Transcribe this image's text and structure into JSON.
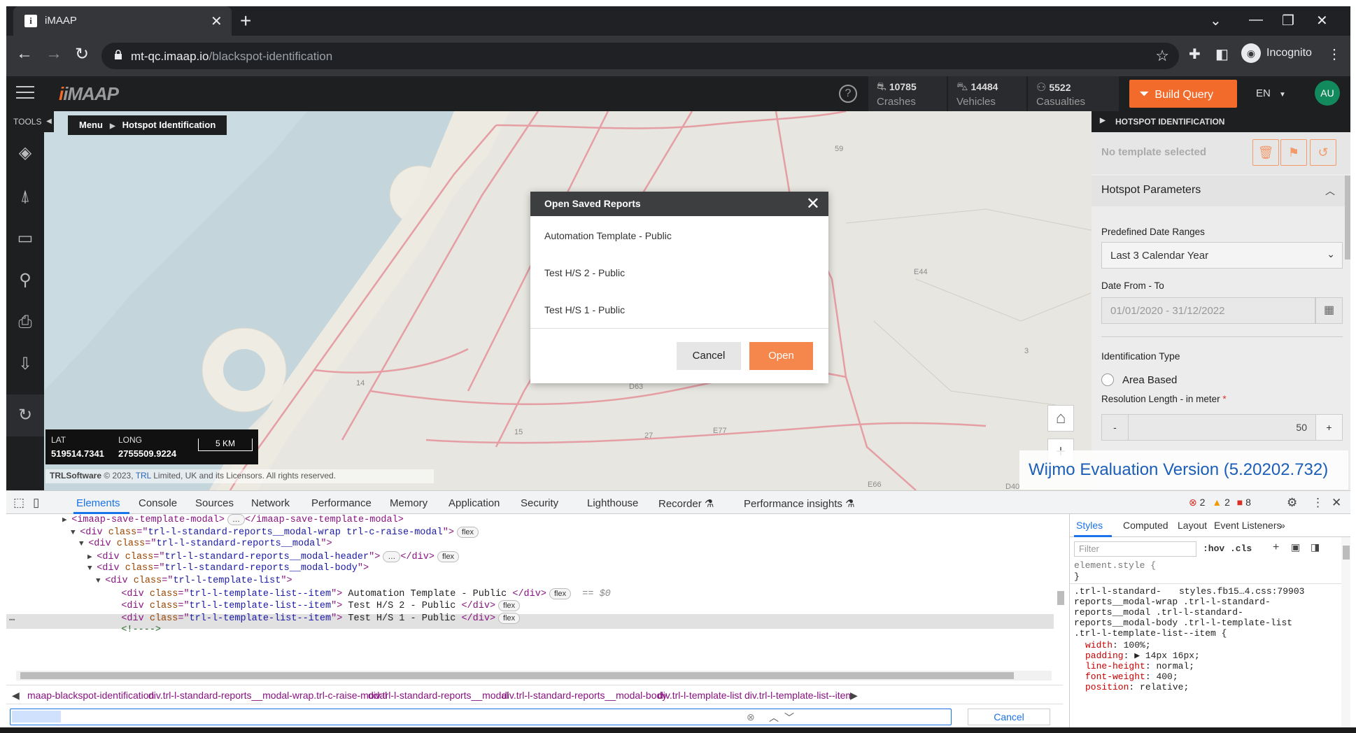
{
  "browser": {
    "tab_title": "iMAAP",
    "tab_favicon": "i",
    "url_host": "mt-qc.imaap.io",
    "url_path": "/blackspot-identification",
    "profile_label": "Incognito"
  },
  "app": {
    "logo_main": "iMAAP",
    "stats": [
      {
        "icon": "crash-icon",
        "value": "10785",
        "label": "Crashes"
      },
      {
        "icon": "car-icon",
        "value": "14484",
        "label": "Vehicles"
      },
      {
        "icon": "person-icon",
        "value": "5522",
        "label": "Casualties"
      }
    ],
    "build_query_label": "Build Query",
    "language": "EN",
    "avatar_initials": "AU",
    "accent_color": "#f36b2a"
  },
  "tools": {
    "label": "TOOLS"
  },
  "breadcrumb": {
    "root": "Menu",
    "current": "Hotspot Identification"
  },
  "map": {
    "lat_label": "LAT",
    "lat_value": "519514.7341",
    "long_label": "LONG",
    "long_value": "2755509.9224",
    "scale_label": "5 KM",
    "attribution_brand": "TRLSoftware",
    "attribution_pre": "© 2023, ",
    "attribution_link": "TRL",
    "attribution_post": " Limited, UK and its Licensors. All rights reserved.",
    "watermark": "Wijmo Evaluation Version (5.20202.732)",
    "road_labels": [
      "E44",
      "E77",
      "E66",
      "D40",
      "D63",
      "59",
      "27",
      "15",
      "14",
      "3"
    ]
  },
  "modal": {
    "title": "Open Saved Reports",
    "items": [
      "Automation Template - Public",
      "Test H/S 2 - Public",
      "Test H/S 1 - Public"
    ],
    "cancel_label": "Cancel",
    "open_label": "Open"
  },
  "panel": {
    "header": "HOTSPOT IDENTIFICATION",
    "template_placeholder": "No template selected",
    "section_title": "Hotspot Parameters",
    "date_ranges_label": "Predefined Date Ranges",
    "date_ranges_value": "Last 3 Calendar Year",
    "date_from_to_label": "Date From - To",
    "date_from_to_value": "01/01/2020 - 31/12/2022",
    "identification_type_label": "Identification Type",
    "area_based_label": "Area Based",
    "resolution_label": "Resolution Length - in meter",
    "required_mark": "*",
    "resolution_minus": "-",
    "resolution_value": "50",
    "resolution_plus": "+"
  },
  "devtools": {
    "tabs": [
      "Elements",
      "Console",
      "Sources",
      "Network",
      "Performance",
      "Memory",
      "Application",
      "Security",
      "Lighthouse",
      "Recorder",
      "Performance insights"
    ],
    "errors": "2",
    "warnings": "2",
    "issues": "8",
    "dom_lines": [
      {
        "indent": 0,
        "tri": "▶",
        "open": "<imaap-save-template-modal>",
        "mid": "",
        "close": "</imaap-save-template-modal>"
      },
      {
        "indent": 1,
        "tri": "▼",
        "cls": "trl-l-standard-reports__modal-wrap trl-c-raise-modal",
        "badge": "flex"
      },
      {
        "indent": 2,
        "tri": "▼",
        "cls": "trl-l-standard-reports__modal"
      },
      {
        "indent": 3,
        "tri": "▶",
        "cls": "trl-l-standard-reports__modal-header",
        "ellipsis": true,
        "badge": "flex"
      },
      {
        "indent": 3,
        "tri": "▼",
        "cls": "trl-l-standard-reports__modal-body"
      },
      {
        "indent": 4,
        "tri": "▼",
        "cls": "trl-l-template-list"
      },
      {
        "indent": 5,
        "tri": "",
        "cls": "trl-l-template-list--item",
        "text": " Automation Template - Public ",
        "badge": "flex",
        "selected": true
      },
      {
        "indent": 5,
        "tri": "",
        "cls": "trl-l-template-list--item",
        "text": " Test H/S 2 - Public ",
        "badge": "flex"
      },
      {
        "indent": 5,
        "tri": "",
        "cls": "trl-l-template-list--item",
        "text": " Test H/S 1 - Public ",
        "badge": "flex"
      },
      {
        "indent": 5,
        "tri": "",
        "comment": "<!---->"
      }
    ],
    "eq_marker": "== $0",
    "crumbs": [
      "maap-blackspot-identification",
      "div.trl-l-standard-reports__modal-wrap.trl-c-raise-modal",
      "div.trl-l-standard-reports__modal",
      "div.trl-l-standard-reports__modal-body",
      "div.trl-l-template-list",
      "div.trl-l-template-list--item"
    ],
    "find_cancel": "Cancel",
    "style_tabs": [
      "Styles",
      "Computed",
      "Layout",
      "Event Listeners"
    ],
    "filter_placeholder": "Filter",
    "filter_tools": ":hov .cls",
    "element_style": "element.style {",
    "closing_brace": "}",
    "css_source": "styles.fb15…4.css:79903",
    "selector_lines": [
      ".trl-l-standard-",
      "reports__modal-wrap .trl-l-standard-",
      "reports__modal .trl-l-standard-",
      "reports__modal-body .trl-l-template-list",
      ".trl-l-template-list--item {"
    ],
    "props": [
      {
        "name": "width",
        "value": "100%;"
      },
      {
        "name": "padding",
        "value": "▶ 14px 16px;"
      },
      {
        "name": "line-height",
        "value": "normal;"
      },
      {
        "name": "font-weight",
        "value": "400;"
      },
      {
        "name": "position",
        "value": "relative;"
      }
    ]
  }
}
